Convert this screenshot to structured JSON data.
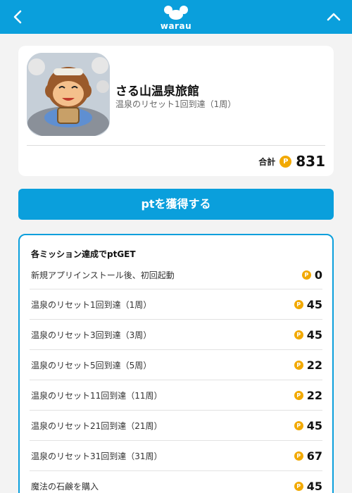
{
  "header": {
    "logo_text": "warau",
    "colors": {
      "primary": "#0a9fdc",
      "coin": "#f2a900"
    }
  },
  "app": {
    "title": "さる山温泉旅館",
    "subtitle": "温泉のリセット1回到達（1周）",
    "total_label": "合計",
    "total_points": "831",
    "coin_symbol": "P"
  },
  "cta": {
    "label": "ptを獲得する"
  },
  "missions": {
    "heading": "各ミッション達成でptGET",
    "items": [
      {
        "label": "新規アプリインストール後、初回起動",
        "points": "0"
      },
      {
        "label": "温泉のリセット1回到達（1周）",
        "points": "45"
      },
      {
        "label": "温泉のリセット3回到達（3周）",
        "points": "45"
      },
      {
        "label": "温泉のリセット5回到達（5周）",
        "points": "22"
      },
      {
        "label": "温泉のリセット11回到達（11周）",
        "points": "22"
      },
      {
        "label": "温泉のリセット21回到達（21周）",
        "points": "45"
      },
      {
        "label": "温泉のリセット31回到達（31周）",
        "points": "67"
      },
      {
        "label": "魔法の石鹸を購入",
        "points": "45"
      }
    ]
  }
}
